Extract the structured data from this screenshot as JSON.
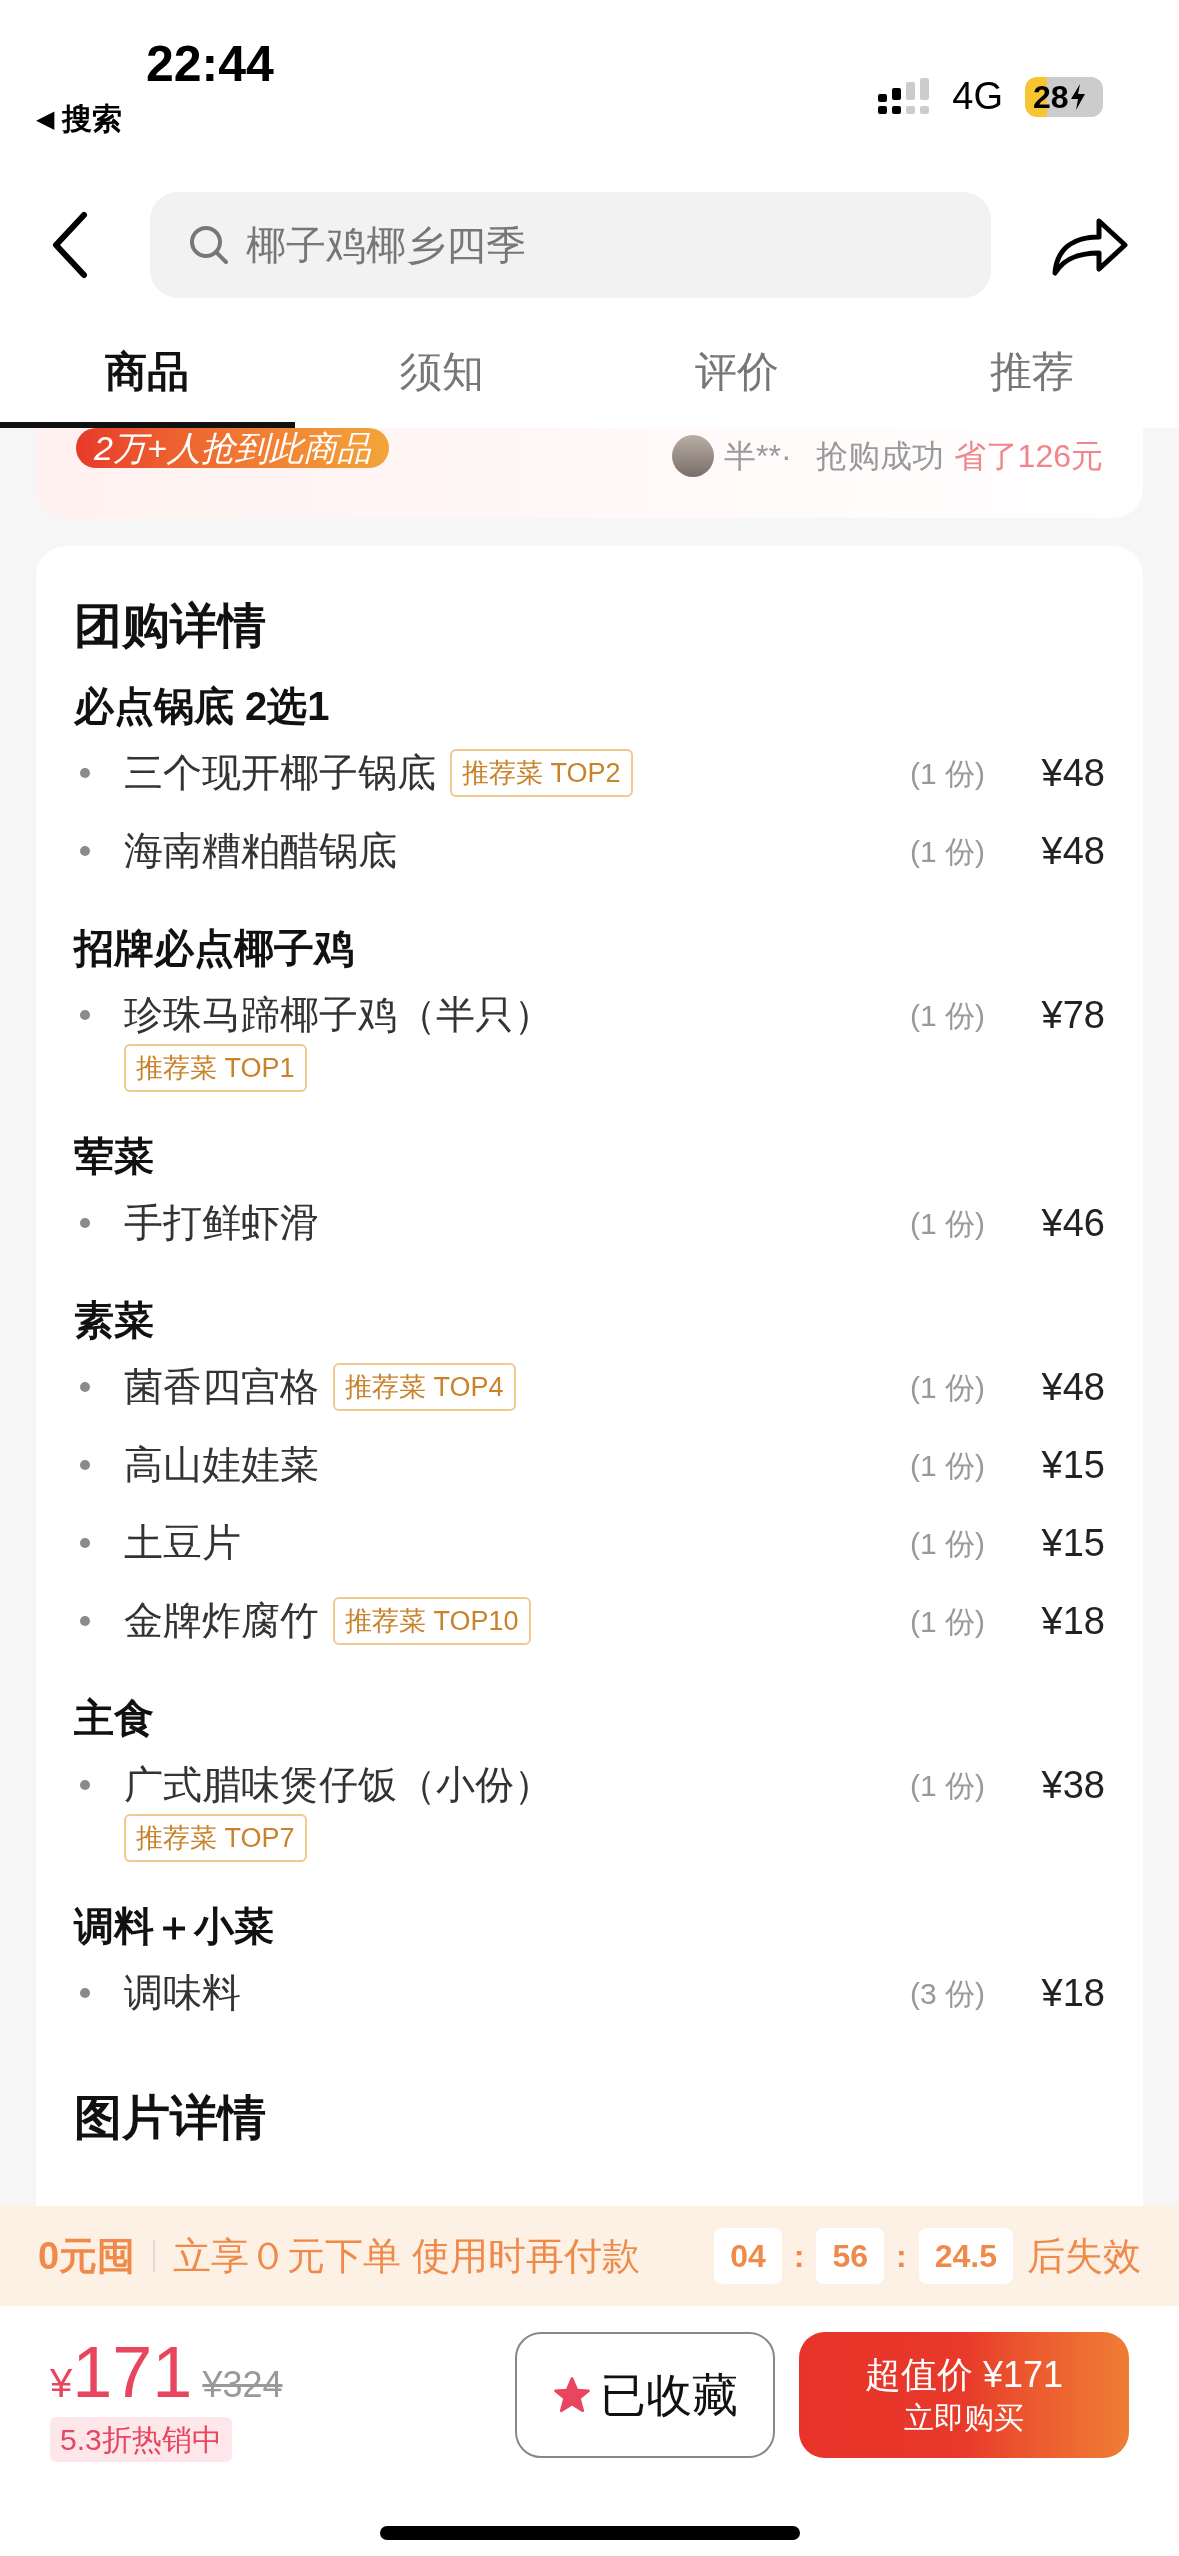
{
  "status_bar": {
    "time": "22:44",
    "back_arrow": "◀",
    "back_label": "搜索",
    "network": "4G",
    "battery": "28"
  },
  "header": {
    "search": {
      "placeholder": "椰子鸡椰乡四季"
    }
  },
  "tabs": [
    {
      "label": "商品",
      "selected": true
    },
    {
      "label": "须知",
      "selected": false
    },
    {
      "label": "评价",
      "selected": false
    },
    {
      "label": "推荐",
      "selected": false
    }
  ],
  "sales_strip": {
    "badge": "2万+人抢到此商品",
    "user": "半**·",
    "action": "抢购成功",
    "savings": "省了126元"
  },
  "details": {
    "title": "团购详情",
    "groups": [
      {
        "title": "必点锅底 2选1",
        "items": [
          {
            "name": "三个现开椰子锅底",
            "tag": "推荐菜 TOP2",
            "qty": "(1 份)",
            "price": "¥48"
          },
          {
            "name": "海南糟粕醋锅底",
            "qty": "(1 份)",
            "price": "¥48"
          }
        ]
      },
      {
        "title": "招牌必点椰子鸡",
        "items": [
          {
            "name": "珍珠马蹄椰子鸡（半只）",
            "tag": "推荐菜 TOP1",
            "tag_below": true,
            "qty": "(1 份)",
            "price": "¥78"
          }
        ]
      },
      {
        "title": "荤菜",
        "items": [
          {
            "name": "手打鲜虾滑",
            "qty": "(1 份)",
            "price": "¥46"
          }
        ]
      },
      {
        "title": "素菜",
        "items": [
          {
            "name": "菌香四宫格",
            "tag": "推荐菜 TOP4",
            "qty": "(1 份)",
            "price": "¥48"
          },
          {
            "name": "高山娃娃菜",
            "qty": "(1 份)",
            "price": "¥15"
          },
          {
            "name": "土豆片",
            "qty": "(1 份)",
            "price": "¥15"
          },
          {
            "name": "金牌炸腐竹",
            "tag": "推荐菜 TOP10",
            "qty": "(1 份)",
            "price": "¥18"
          }
        ]
      },
      {
        "title": "主食",
        "items": [
          {
            "name": "广式腊味煲仔饭（小份）",
            "tag": "推荐菜 TOP7",
            "tag_below": true,
            "qty": "(1 份)",
            "price": "¥38"
          }
        ]
      },
      {
        "title": "调料＋小菜",
        "items": [
          {
            "name": "调味料",
            "qty": "(3 份)",
            "price": "¥18"
          }
        ]
      }
    ],
    "next_section_title": "图片详情"
  },
  "promo_banner": {
    "logo": "0元囤",
    "text": "立享０元下单 使用时再付款",
    "countdown": [
      "04",
      "56",
      "24.5"
    ],
    "separators": [
      ":",
      ":"
    ],
    "suffix": "后失效"
  },
  "bottom_bar": {
    "currency": "¥",
    "price": "171",
    "original_price": "¥324",
    "discount": "5.3折热销中",
    "favorite": {
      "label": "已收藏",
      "on": true
    },
    "buy": {
      "title": "超值价 ¥171",
      "subtitle": "立即购买"
    }
  }
}
